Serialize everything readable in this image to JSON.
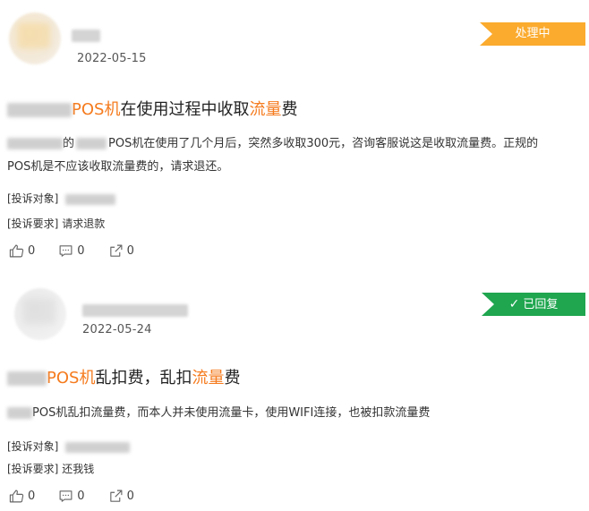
{
  "complaints": [
    {
      "date": "2022-05-15",
      "status": "处理中",
      "title_mid": "POS机",
      "title_mid2": "在使用过程中收取",
      "title_hl": "流量",
      "title_end": "费",
      "body_a": "的",
      "body_b": "POS机在使用了几个月后，突然多收取300元，咨询客服说这是收取流量费。正规的",
      "body_c": "POS机是不应该收取流量费的，请求退还。",
      "target_label": "[投诉对象]",
      "request_label": "[投诉要求]",
      "request_value": "请求退款",
      "likes": "0",
      "comments": "0",
      "shares": "0"
    },
    {
      "date": "2022-05-24",
      "status": "已回复",
      "title_hl1": "POS机",
      "title_mid": "乱扣费，乱扣",
      "title_hl": "流量",
      "title_end": "费",
      "body": "POS机乱扣流量费，而本人并未使用流量卡，使用WIFI连接，也被扣款流量费",
      "target_label": "[投诉对象]",
      "request_label": "[投诉要求]",
      "request_value": "还我钱",
      "likes": "0",
      "comments": "0",
      "shares": "0"
    }
  ],
  "icons": {
    "like": "thumbs-up-icon",
    "comment": "comment-icon",
    "share": "share-icon",
    "check": "check-icon"
  },
  "colors": {
    "processing": "#fbab2e",
    "replied": "#1fa64f",
    "highlight": "#f57b1e"
  }
}
